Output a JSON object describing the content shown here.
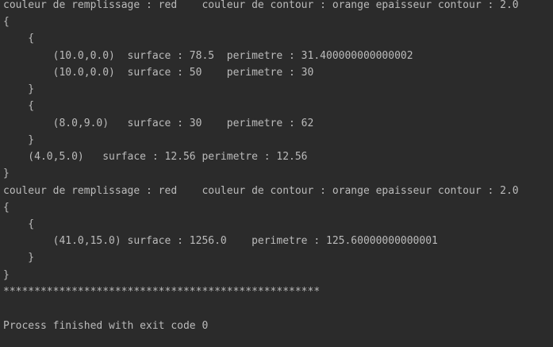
{
  "console": {
    "lines": [
      "couleur de remplissage : red    couleur de contour : orange epaisseur contour : 2.0",
      "{",
      "    {",
      "        (10.0,0.0)  surface : 78.5  perimetre : 31.400000000000002",
      "        (10.0,0.0)  surface : 50    perimetre : 30",
      "    }",
      "    {",
      "        (8.0,9.0)   surface : 30    perimetre : 62",
      "    }",
      "    (4.0,5.0)   surface : 12.56 perimetre : 12.56",
      "}",
      "couleur de remplissage : red    couleur de contour : orange epaisseur contour : 2.0",
      "{",
      "    {",
      "        (41.0,15.0) surface : 1256.0    perimetre : 125.60000000000001",
      "    }",
      "}",
      "***************************************************",
      "",
      "Process finished with exit code 0"
    ]
  }
}
